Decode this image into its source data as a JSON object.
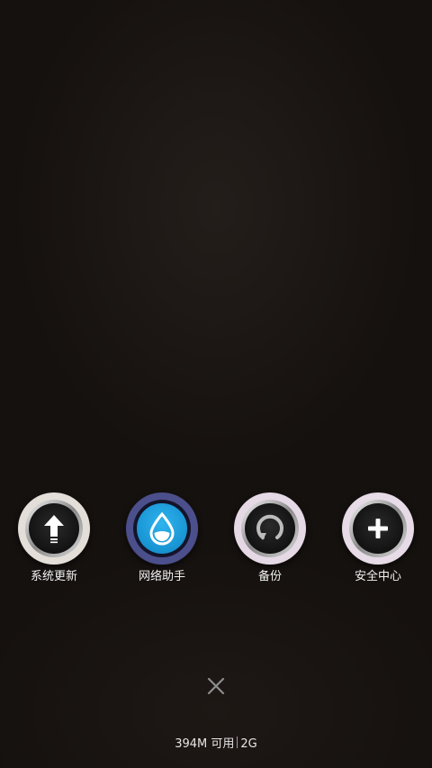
{
  "apps": [
    {
      "label": "系统更新",
      "icon": "arrow-up-icon",
      "ring_color": "#e3dfd8"
    },
    {
      "label": "网络助手",
      "icon": "water-drop-icon",
      "ring_color": "#4b4f8c"
    },
    {
      "label": "备份",
      "icon": "backup-refresh-icon",
      "ring_color": "#e6d9e6"
    },
    {
      "label": "安全中心",
      "icon": "plus-icon",
      "ring_color": "#e6dbe6"
    }
  ],
  "close": {
    "icon": "close-icon"
  },
  "status": {
    "memory": "394M 可用",
    "total": "2G"
  },
  "colors": {
    "background": "#15110f",
    "accent_blue": "#1fa3e0"
  }
}
